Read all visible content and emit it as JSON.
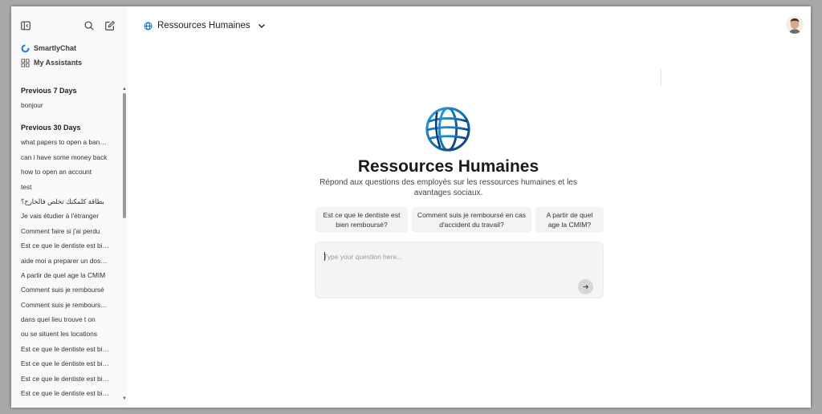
{
  "sidebar": {
    "brand_label": "SmartlyChat",
    "assistants_label": "My Assistants",
    "sections": [
      {
        "title": "Previous 7 Days",
        "items": [
          "bonjour"
        ]
      },
      {
        "title": "Previous 30 Days",
        "items": [
          "what papers to open a bank account",
          "can i have some money back",
          "how to open an account",
          "test",
          "بطاقة كلمكتك تخلص فالخارج؟",
          "Je vais étudier à l'étranger",
          "Comment faire si j'ai perdu",
          "Est ce que le dentiste est bien remboursé",
          "aide moi a preparer un dossier",
          "A partir de quel age la CMIM",
          "Comment suis je remboursé",
          "Comment suis je remboursé en cas",
          "dans quel lieu trouve t on",
          "ou se situent les locations",
          "Est ce que le dentiste est bien remboursé",
          "Est ce que le dentiste est bien remboursé",
          "Est ce que le dentiste est bien remboursé",
          "Est ce que le dentiste est bien remboursé"
        ]
      }
    ]
  },
  "header": {
    "assistant_title": "Ressources Humaines"
  },
  "main": {
    "assistant_name": "Ressources Humaines",
    "assistant_description": "Répond aux questions des employés sur les ressources humaines et les avantages sociaux.",
    "suggestions": [
      "Est ce que le dentiste est bien remboursé?",
      "Comment suis je remboursé en cas d'accident du travail?",
      "A partir de quel age la CMIM?"
    ],
    "composer": {
      "placeholder": "Type your question here...",
      "value": ""
    }
  },
  "colors": {
    "sidebar_bg": "#f9f9f9",
    "brand_blue": "#1a7fd4",
    "globe_dark": "#0b3a75"
  },
  "icons": {
    "sidebar_toggle": "sidebar-toggle-icon",
    "search": "search-icon",
    "new_chat": "new-chat-icon",
    "brand": "smartlychat-logo-icon",
    "assistants": "grid-icon",
    "chevron": "chevron-down-icon",
    "send": "arrow-right-icon"
  }
}
